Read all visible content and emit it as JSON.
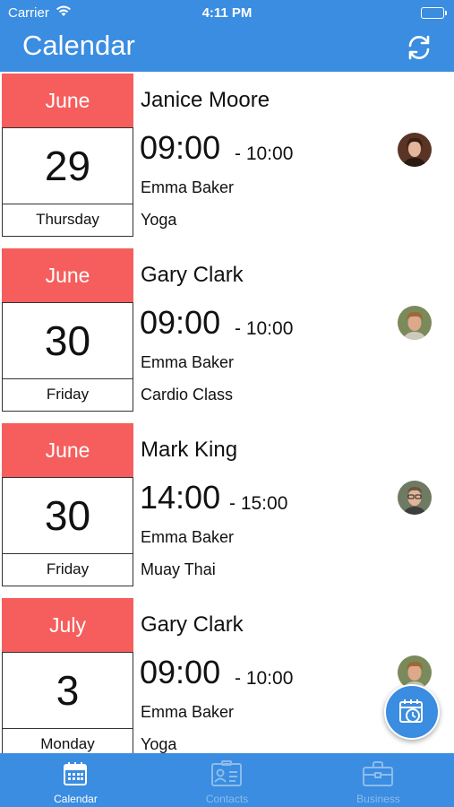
{
  "status_bar": {
    "carrier": "Carrier",
    "time": "4:11 PM"
  },
  "header": {
    "title": "Calendar"
  },
  "appointments": [
    {
      "month": "June",
      "day": "29",
      "weekday": "Thursday",
      "client": "Janice Moore",
      "start": "09:00",
      "end": "- 10:00",
      "staff": "Emma Baker",
      "service": "Yoga"
    },
    {
      "month": "June",
      "day": "30",
      "weekday": "Friday",
      "client": "Gary Clark",
      "start": "09:00",
      "end": "- 10:00",
      "staff": "Emma Baker",
      "service": "Cardio Class"
    },
    {
      "month": "June",
      "day": "30",
      "weekday": "Friday",
      "client": "Mark King",
      "start": "14:00",
      "end": "- 15:00",
      "staff": "Emma Baker",
      "service": "Muay Thai"
    },
    {
      "month": "July",
      "day": "3",
      "weekday": "Monday",
      "client": "Gary Clark",
      "start": "09:00",
      "end": "- 10:00",
      "staff": "Emma Baker",
      "service": "Yoga"
    }
  ],
  "tabs": [
    {
      "label": "Calendar",
      "icon": "calendar-icon",
      "active": true
    },
    {
      "label": "Contacts",
      "icon": "contact-card-icon",
      "active": false
    },
    {
      "label": "Business",
      "icon": "briefcase-icon",
      "active": false
    }
  ],
  "colors": {
    "primary": "#3a8de0",
    "month_header": "#f55e5c",
    "inactive_tab": "#8dbcec"
  }
}
